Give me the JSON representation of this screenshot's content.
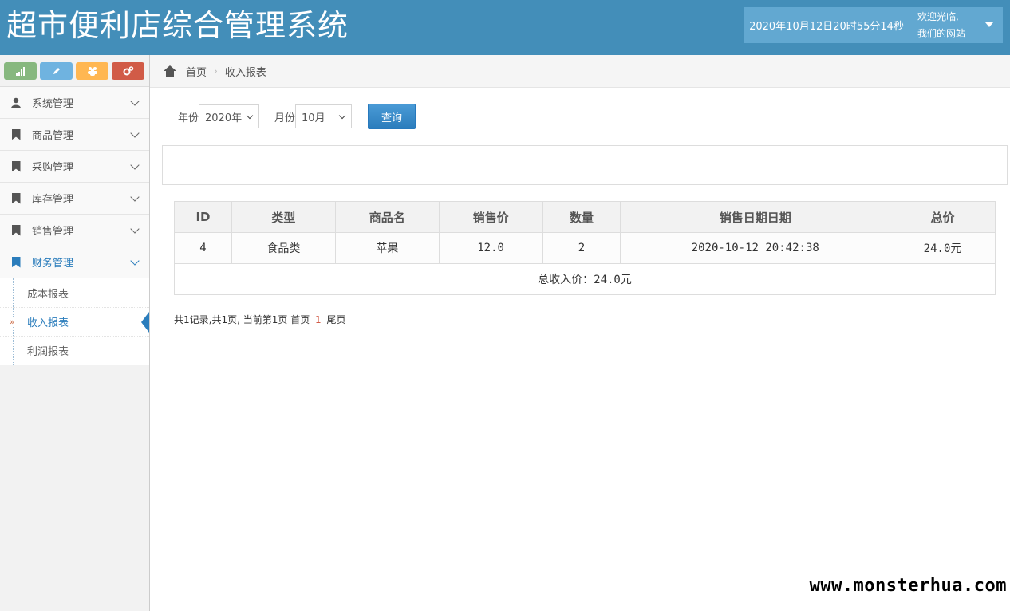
{
  "app": {
    "title": "超市便利店综合管理系统",
    "datetime": "2020年10月12日20时55分14秒",
    "welcome_line1": "欢迎光临,",
    "welcome_line2": "我们的网站"
  },
  "sidebar": {
    "shortcuts": [
      {
        "icon": "signal-icon",
        "color": "#87b87f"
      },
      {
        "icon": "pencil-icon",
        "color": "#6fb3e0"
      },
      {
        "icon": "users-icon",
        "color": "#ffb752"
      },
      {
        "icon": "cogs-icon",
        "color": "#d15b47"
      }
    ],
    "items": [
      {
        "label": "系统管理",
        "icon": "user-icon"
      },
      {
        "label": "商品管理",
        "icon": "bookmark-icon"
      },
      {
        "label": "采购管理",
        "icon": "bookmark-icon"
      },
      {
        "label": "库存管理",
        "icon": "bookmark-icon"
      },
      {
        "label": "销售管理",
        "icon": "bookmark-icon"
      },
      {
        "label": "财务管理",
        "icon": "bookmark-icon",
        "active": true
      }
    ],
    "submenu": [
      {
        "label": "成本报表"
      },
      {
        "label": "收入报表",
        "active": true
      },
      {
        "label": "利润报表"
      }
    ]
  },
  "breadcrumb": {
    "home": "首页",
    "current": "收入报表"
  },
  "filter": {
    "year_label": "年份",
    "year_value": "2020年",
    "month_label": "月份",
    "month_value": "10月",
    "query_label": "查询"
  },
  "table": {
    "headers": [
      "ID",
      "类型",
      "商品名",
      "销售价",
      "数量",
      "销售日期日期",
      "总价"
    ],
    "rows": [
      [
        "4",
        "食品类",
        "苹果",
        "12.0",
        "2",
        "2020-10-12 20:42:38",
        "24.0元"
      ]
    ],
    "total": "总收入价：24.0元"
  },
  "pager": {
    "summary": "共1记录,共1页, 当前第1页",
    "first": "首页",
    "current": "1",
    "last": "尾页"
  },
  "watermark": "www.monsterhua.com",
  "colors": {
    "header": "#438eb9",
    "accent": "#2b7dbc"
  }
}
